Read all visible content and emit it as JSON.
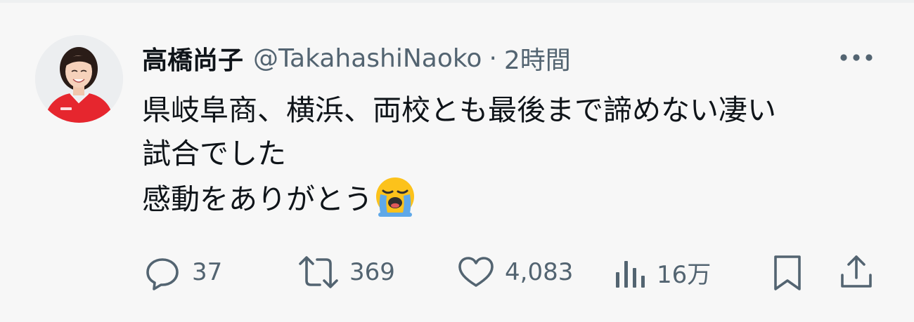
{
  "tweet": {
    "author": {
      "display_name": "高橋尚子",
      "handle": "@TakahashiNaoko",
      "separator": "·",
      "time": "2時間"
    },
    "text_lines": [
      "県岐阜商、横浜、両校とも最後まで諦めない凄い",
      "試合でした",
      "感動をありがとう"
    ],
    "emoji": "loudly-crying-face-emoji"
  },
  "actions": {
    "replies": "37",
    "reposts": "369",
    "likes": "4,083",
    "views": "16万"
  },
  "colors": {
    "background": "#f7f7f7",
    "text_primary": "#0f1419",
    "text_secondary": "#536471",
    "avatar_shirt": "#e6262e"
  },
  "icons": [
    "more-icon",
    "reply-icon",
    "repost-icon",
    "like-icon",
    "views-icon",
    "bookmark-icon",
    "share-icon"
  ]
}
